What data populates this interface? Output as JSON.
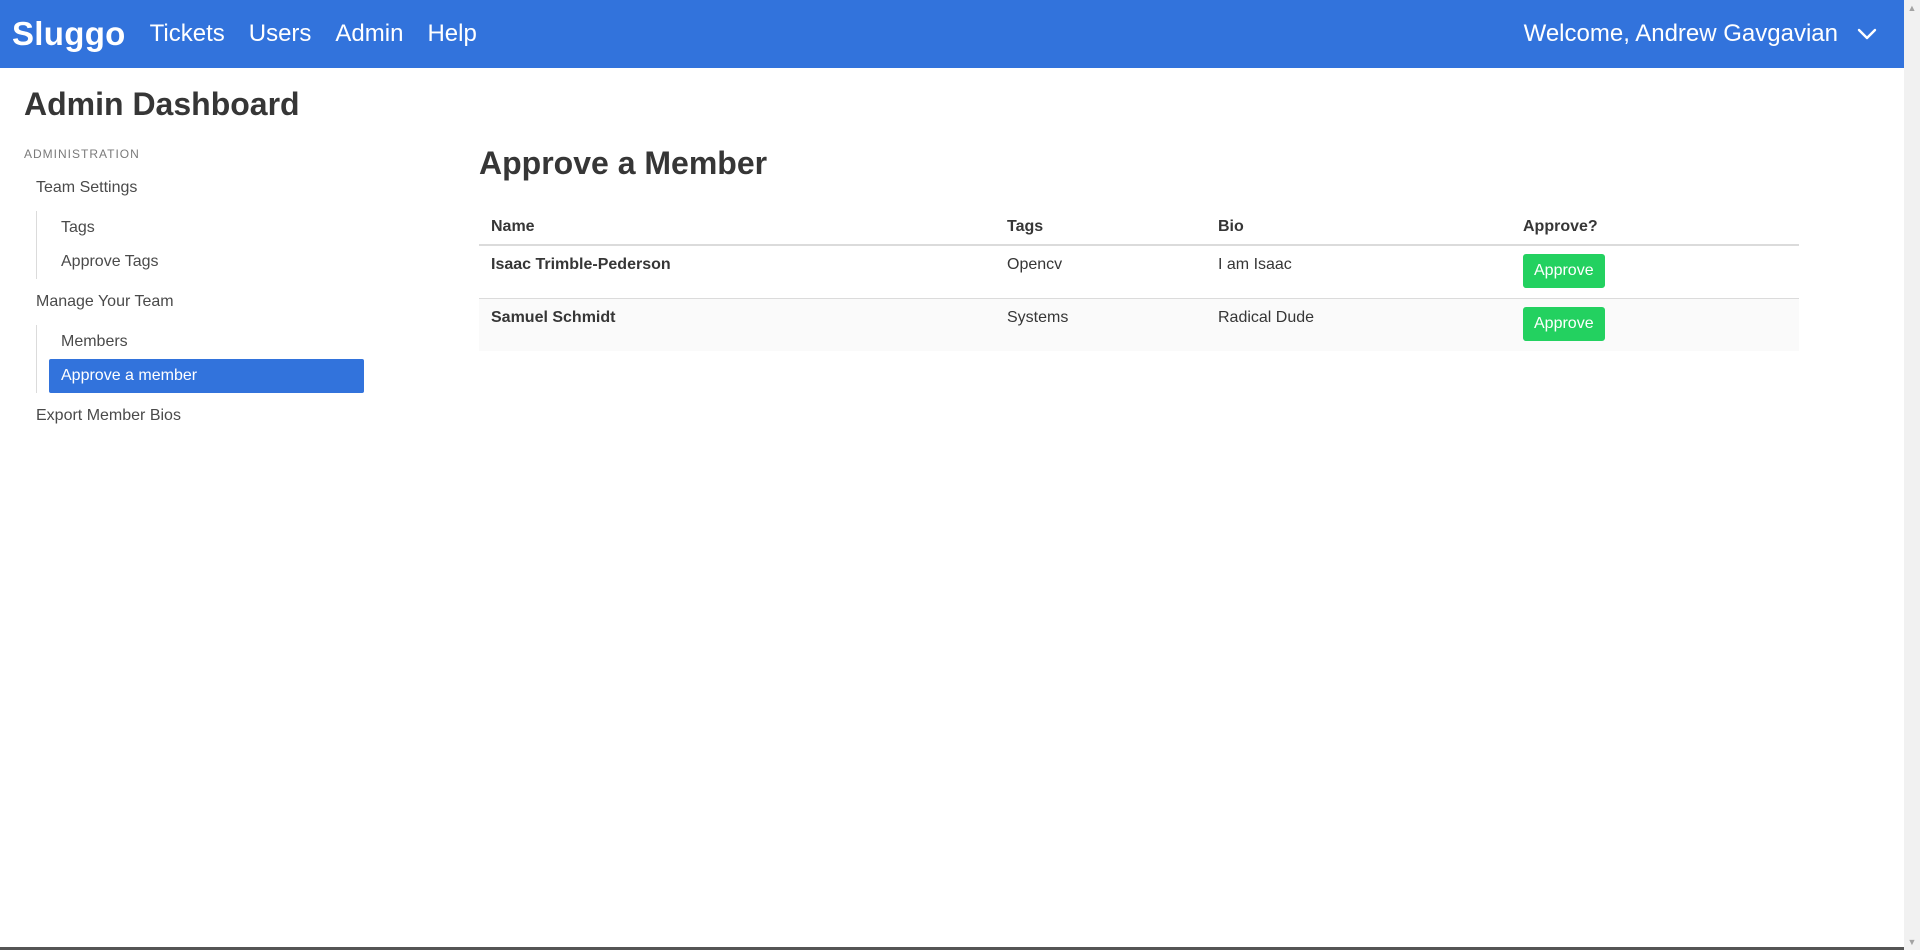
{
  "navbar": {
    "brand": "Sluggo",
    "links": [
      "Tickets",
      "Users",
      "Admin",
      "Help"
    ],
    "welcome": "Welcome, Andrew Gavgavian",
    "dropdown_icon": "chevron-down-icon",
    "bg_color": "#3273dc"
  },
  "sidebar": {
    "title": "Admin Dashboard",
    "section_label": "ADMINISTRATION",
    "team_settings": "Team Settings",
    "team_settings_items": [
      "Tags",
      "Approve Tags"
    ],
    "manage_team": "Manage Your Team",
    "manage_team_items": [
      "Members",
      "Approve a member"
    ],
    "active_item": "Approve a member",
    "export_bios": "Export Member Bios"
  },
  "main": {
    "title": "Approve a Member",
    "columns": [
      "Name",
      "Tags",
      "Bio",
      "Approve?"
    ],
    "rows": [
      {
        "name": "Isaac Trimble-Pederson",
        "tags": "Opencv",
        "bio": "I am Isaac",
        "action": "Approve"
      },
      {
        "name": "Samuel Schmidt",
        "tags": "Systems",
        "bio": "Radical Dude",
        "action": "Approve"
      }
    ],
    "approve_color": "#23d160"
  }
}
